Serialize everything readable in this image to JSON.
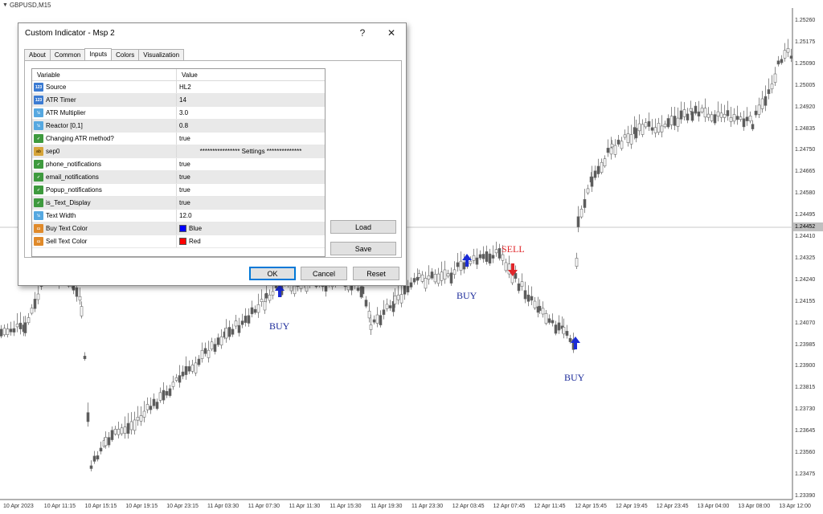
{
  "chart": {
    "symbol": "GBPUSD,M15",
    "current_price": "1.24452",
    "price_ticks": [
      "1.25260",
      "1.25175",
      "1.25090",
      "1.25005",
      "1.24920",
      "1.24835",
      "1.24750",
      "1.24665",
      "1.24580",
      "1.24495",
      "1.24410",
      "1.24325",
      "1.24240",
      "1.24155",
      "1.24070",
      "1.23985",
      "1.23900",
      "1.23815",
      "1.23730",
      "1.23645",
      "1.23560",
      "1.23475",
      "1.23390"
    ],
    "time_ticks": [
      "10 Apr 2023",
      "10 Apr 11:15",
      "10 Apr 15:15",
      "10 Apr 19:15",
      "10 Apr 23:15",
      "11 Apr 03:30",
      "11 Apr 07:30",
      "11 Apr 11:30",
      "11 Apr 15:30",
      "11 Apr 19:30",
      "11 Apr 23:30",
      "12 Apr 03:45",
      "12 Apr 07:45",
      "12 Apr 11:45",
      "12 Apr 15:45",
      "12 Apr 19:45",
      "12 Apr 23:45",
      "13 Apr 04:00",
      "13 Apr 08:00",
      "13 Apr 12:00"
    ],
    "signals": [
      {
        "label": "BUY",
        "kind": "buy"
      },
      {
        "label": "BUY",
        "kind": "buy"
      },
      {
        "label": "SELL",
        "kind": "sell"
      },
      {
        "label": "BUY",
        "kind": "buy"
      }
    ],
    "colors": {
      "buy": "#1a2bd6",
      "sell": "#e0262a",
      "candle": "#8c8c8c"
    }
  },
  "dialog": {
    "title": "Custom Indicator - Msp 2",
    "help_label": "?",
    "close_label": "✕",
    "tabs": [
      "About",
      "Common",
      "Inputs",
      "Colors",
      "Visualization"
    ],
    "active_tab": "Inputs",
    "columns": {
      "variable": "Variable",
      "value": "Value"
    },
    "rows": [
      {
        "icon": "int-icon",
        "icon_text": "123",
        "variable": "Source",
        "value": "HL2"
      },
      {
        "icon": "int-icon",
        "icon_text": "123",
        "variable": "ATR Timer",
        "value": "14"
      },
      {
        "icon": "double-icon",
        "icon_text": "½",
        "variable": "ATR Multiplier",
        "value": "3.0"
      },
      {
        "icon": "double-icon",
        "icon_text": "½",
        "variable": "Reactor [0,1]",
        "value": "0.8"
      },
      {
        "icon": "bool-icon",
        "icon_text": "✓",
        "variable": "Changing ATR method?",
        "value": "true"
      },
      {
        "icon": "string-icon",
        "icon_text": "ab",
        "variable": "sep0",
        "value": "**************** Settings **************"
      },
      {
        "icon": "bool-icon",
        "icon_text": "✓",
        "variable": "phone_notifications",
        "value": "true"
      },
      {
        "icon": "bool-icon",
        "icon_text": "✓",
        "variable": "email_notifications",
        "value": "true"
      },
      {
        "icon": "bool-icon",
        "icon_text": "✓",
        "variable": "Popup_notifications",
        "value": "true"
      },
      {
        "icon": "bool-icon",
        "icon_text": "✓",
        "variable": "is_Text_Display",
        "value": "true"
      },
      {
        "icon": "double-icon",
        "icon_text": "½",
        "variable": "Text Width",
        "value": "12.0"
      },
      {
        "icon": "color-icon",
        "icon_text": "▭",
        "variable": "Buy Text Color",
        "value": "Blue",
        "swatch": "#0000ff"
      },
      {
        "icon": "color-icon",
        "icon_text": "▭",
        "variable": "Sell Text Color",
        "value": "Red",
        "swatch": "#ff0000"
      }
    ],
    "buttons": {
      "load": "Load",
      "save": "Save",
      "ok": "OK",
      "cancel": "Cancel",
      "reset": "Reset"
    }
  }
}
